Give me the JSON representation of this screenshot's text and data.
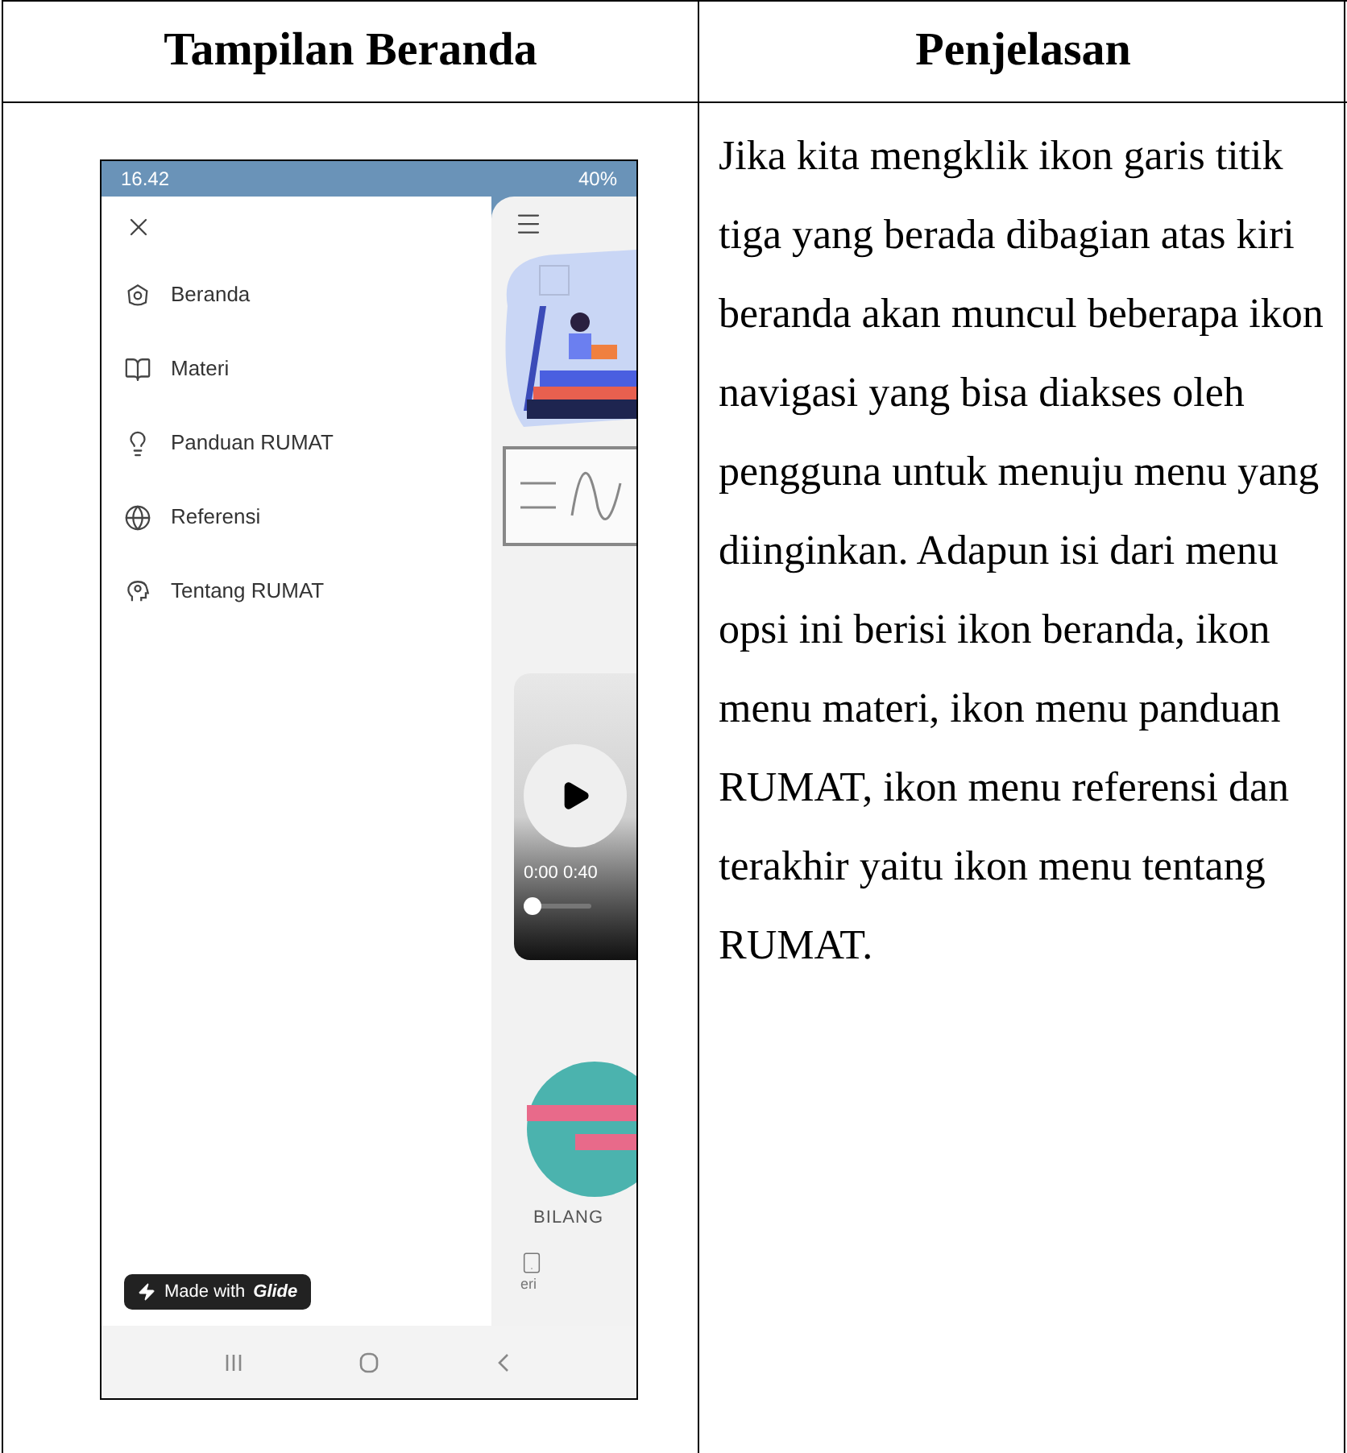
{
  "table": {
    "columns": [
      "Tampilan Beranda",
      "Penjelasan"
    ],
    "explanation": "Jika kita mengklik ikon garis titik tiga yang berada dibagian atas kiri beranda akan muncul beberapa ikon navigasi yang bisa diakses oleh pengguna untuk menuju menu yang diinginkan. Adapun isi dari menu opsi ini berisi ikon beranda, ikon menu materi, ikon menu panduan RUMAT, ikon menu referensi dan terakhir yaitu ikon menu tentang RUMAT."
  },
  "phone": {
    "status_bar": {
      "time": "16.42",
      "battery": "40%"
    },
    "drawer": {
      "items": [
        {
          "label": "Beranda",
          "kind": "home"
        },
        {
          "label": "Materi",
          "kind": "book"
        },
        {
          "label": "Panduan RUMAT",
          "kind": "bulb"
        },
        {
          "label": "Referensi",
          "kind": "globe"
        },
        {
          "label": "Tentang RUMAT",
          "kind": "head"
        }
      ],
      "badge": {
        "prefix": "Made with",
        "brand": "Glide"
      }
    },
    "content": {
      "video": {
        "time": "0:00 0:40",
        "level": 0.12
      },
      "caption": "BILANG",
      "tab_label": "eri"
    }
  }
}
